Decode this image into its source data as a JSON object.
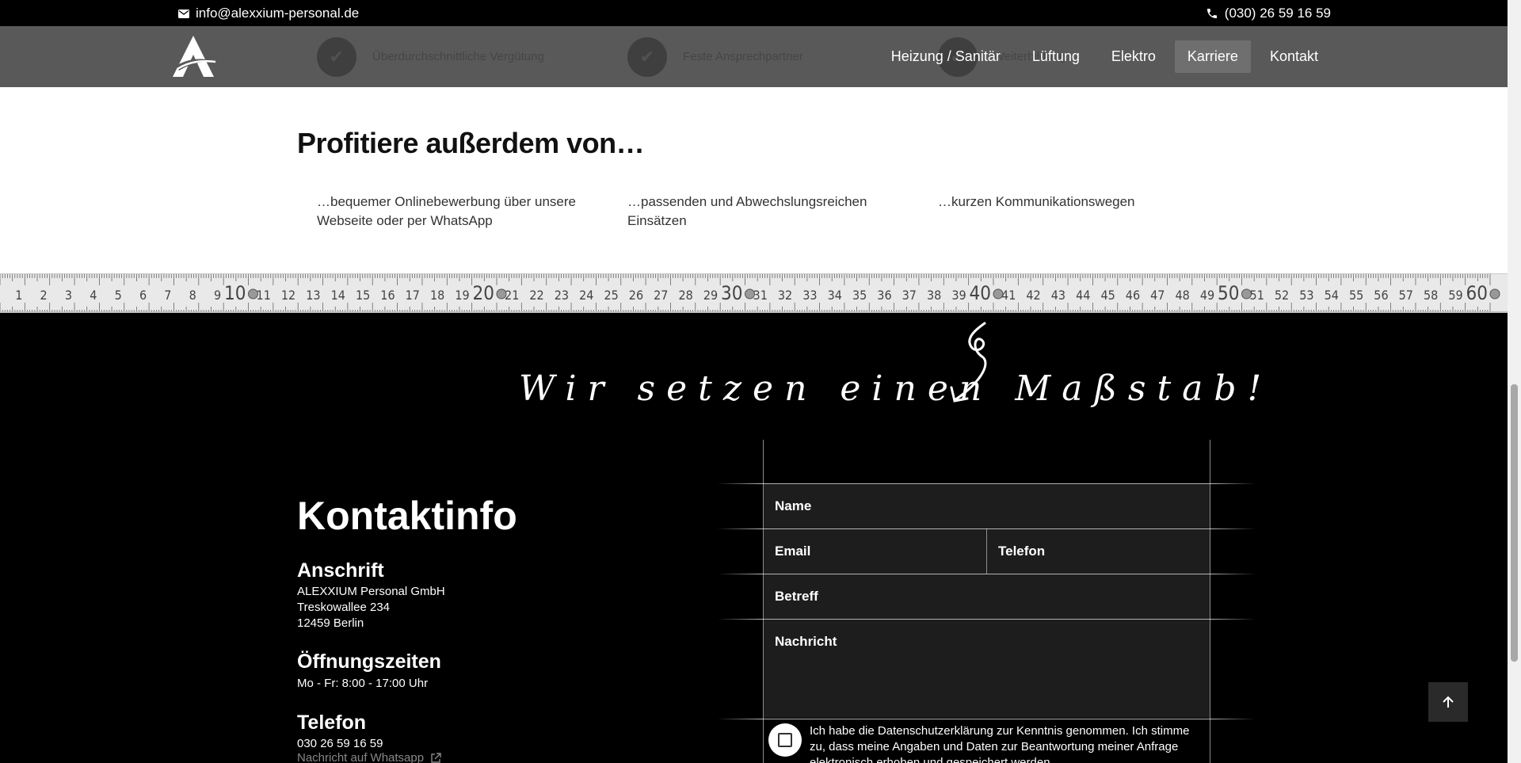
{
  "topbar": {
    "email": "info@alexxium-personal.de",
    "phone": "(030) 26 59 16 59"
  },
  "nav": {
    "ghost_items": [
      "Überdurchschnittliche Vergütung",
      "Feste Ansprechpartner",
      "Weiterbildung"
    ],
    "items": [
      {
        "label": "Heizung / Sanitär",
        "active": false
      },
      {
        "label": "Lüftung",
        "active": false
      },
      {
        "label": "Elektro",
        "active": false
      },
      {
        "label": "Karriere",
        "active": true
      },
      {
        "label": "Kontakt",
        "active": false
      }
    ]
  },
  "benefits": {
    "heading": "Profitiere außerdem von…",
    "items": [
      "…bequemer Onlinebewerbung über unsere Webseite oder per WhatsApp",
      "…passenden und Abwechslungsreichen Einsätzen",
      "…kurzen Kommunikationswegen"
    ]
  },
  "ruler": {
    "numbers": [
      "1",
      "2",
      "3",
      "4",
      "5",
      "6",
      "7",
      "8",
      "9",
      "10",
      "11",
      "12",
      "13",
      "14",
      "15",
      "16",
      "17",
      "18",
      "19",
      "20",
      "21",
      "22",
      "23",
      "24",
      "25",
      "26",
      "27",
      "28",
      "29",
      "30",
      "31",
      "32",
      "33",
      "34",
      "35",
      "36",
      "37",
      "38",
      "39",
      "40",
      "41",
      "42",
      "43",
      "44",
      "45",
      "46",
      "47",
      "48",
      "49",
      "50",
      "51",
      "52",
      "53",
      "54",
      "55",
      "56",
      "57",
      "58",
      "59",
      "60"
    ]
  },
  "slogan": "Wir setzen einen Maßstab!",
  "contact": {
    "heading": "Kontaktinfo",
    "address_heading": "Anschrift",
    "address_lines": [
      "ALEXXIUM Personal GmbH",
      "Treskowallee 234",
      "12459 Berlin"
    ],
    "hours_heading": "Öffnungszeiten",
    "hours": "Mo - Fr: 8:00 - 17:00 Uhr",
    "phone_heading": "Telefon",
    "phone": "030 26 59 16 59",
    "whatsapp_link": "Nachricht auf Whatsapp"
  },
  "form": {
    "name": "Name",
    "email": "Email",
    "telefon": "Telefon",
    "betreff": "Betreff",
    "nachricht": "Nachricht",
    "consent": "Ich habe die Datenschutzerklärung zur Kenntnis genommen. Ich stimme zu, dass meine Angaben und Daten zur Beantwortung meiner Anfrage elektronisch erhoben und gespeichert werden."
  },
  "icons": {
    "mail": "mail-icon",
    "phone": "phone-icon",
    "external": "external-link-icon",
    "arrow_up": "arrow-up-icon"
  }
}
